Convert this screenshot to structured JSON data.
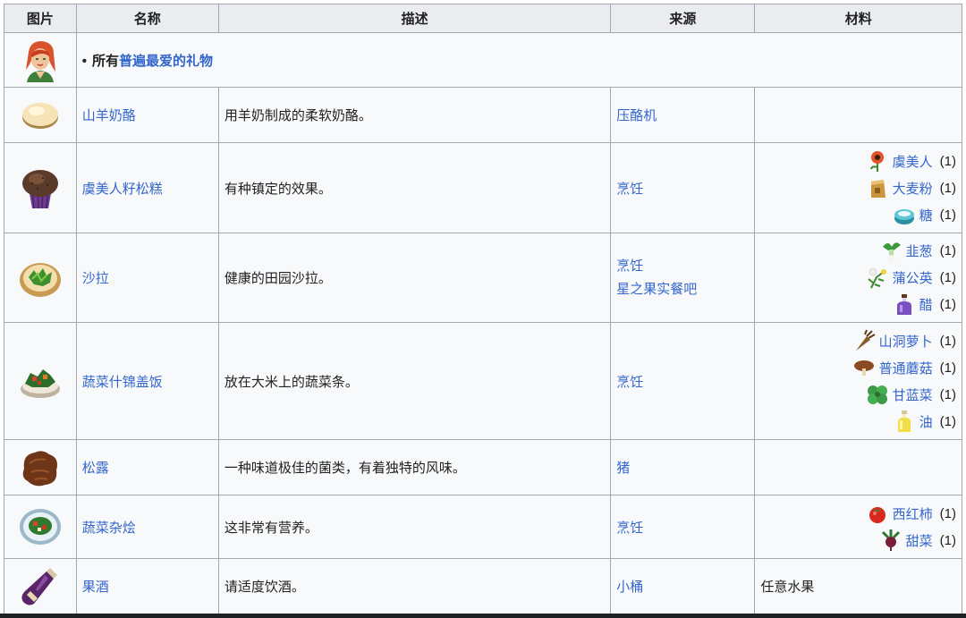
{
  "headers": {
    "image": "图片",
    "name": "名称",
    "desc": "描述",
    "source": "来源",
    "materials": "材料"
  },
  "villager_row": {
    "prefix": "所有",
    "link": "普遍最爱的礼物"
  },
  "items": [
    {
      "icon": "goat-cheese-icon",
      "name": "山羊奶酪",
      "desc": "用羊奶制成的柔软奶酪。",
      "sources": [
        "压酪机"
      ],
      "materials": []
    },
    {
      "icon": "poppyseed-muffin-icon",
      "name": "虞美人籽松糕",
      "desc": "有种镇定的效果。",
      "sources": [
        "烹饪"
      ],
      "materials": [
        {
          "icon": "poppy-icon",
          "name": "虞美人",
          "count": "(1)"
        },
        {
          "icon": "wheat-flour-icon",
          "name": "大麦粉",
          "count": "(1)"
        },
        {
          "icon": "sugar-icon",
          "name": "糖",
          "count": "(1)"
        }
      ]
    },
    {
      "icon": "salad-icon",
      "name": "沙拉",
      "desc": "健康的田园沙拉。",
      "sources": [
        "烹饪",
        "星之果实餐吧"
      ],
      "materials": [
        {
          "icon": "leek-icon",
          "name": "韭葱",
          "count": "(1)"
        },
        {
          "icon": "dandelion-icon",
          "name": "蒲公英",
          "count": "(1)"
        },
        {
          "icon": "vinegar-icon",
          "name": "醋",
          "count": "(1)"
        }
      ]
    },
    {
      "icon": "vegetable-medley-rice-icon",
      "name": "蔬菜什锦盖饭",
      "desc": "放在大米上的蔬菜条。",
      "sources": [
        "烹饪"
      ],
      "materials": [
        {
          "icon": "cave-carrot-icon",
          "name": "山洞萝卜",
          "count": "(1)"
        },
        {
          "icon": "common-mushroom-icon",
          "name": "普通蘑菇",
          "count": "(1)"
        },
        {
          "icon": "kale-icon",
          "name": "甘蓝菜",
          "count": "(1)"
        },
        {
          "icon": "oil-icon",
          "name": "油",
          "count": "(1)"
        }
      ]
    },
    {
      "icon": "truffle-icon",
      "name": "松露",
      "desc": "一种味道极佳的菌类，有着独特的风味。",
      "sources": [
        "猪"
      ],
      "materials": []
    },
    {
      "icon": "vegetable-medley-icon",
      "name": "蔬菜杂烩",
      "desc": "这非常有营养。",
      "sources": [
        "烹饪"
      ],
      "materials": [
        {
          "icon": "tomato-icon",
          "name": "西红柿",
          "count": "(1)"
        },
        {
          "icon": "beet-icon",
          "name": "甜菜",
          "count": "(1)"
        }
      ]
    },
    {
      "icon": "wine-icon",
      "name": "果酒",
      "desc": "请适度饮酒。",
      "sources": [
        "小桶"
      ],
      "materials_text": "任意水果",
      "materials": []
    }
  ]
}
